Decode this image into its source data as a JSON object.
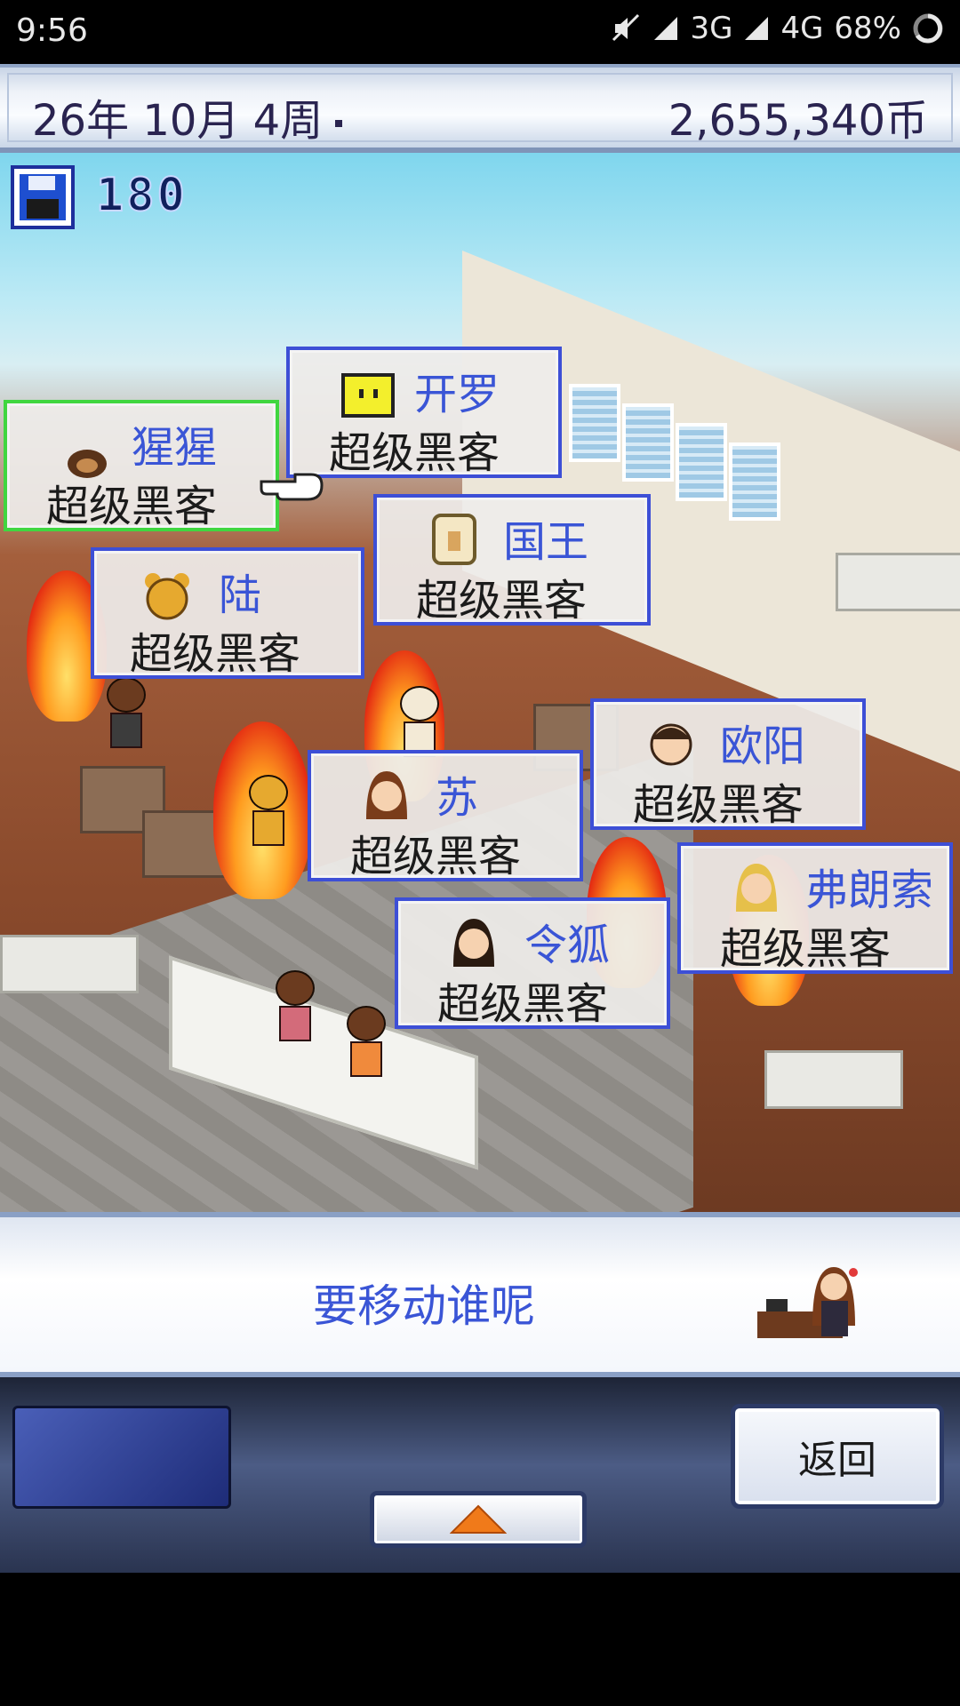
{
  "status_bar": {
    "time": "9:56",
    "network_3g": "3G",
    "network_4g": "4G",
    "battery": "68%"
  },
  "header": {
    "date": "26年 10月 4周",
    "money": "2,655,340币"
  },
  "save_count": "180",
  "employees": [
    {
      "name": "猩猩",
      "role": "超级黑客",
      "avatar": "gorilla-avatar-icon",
      "selected": true
    },
    {
      "name": "开罗",
      "role": "超级黑客",
      "avatar": "kairo-robot-avatar-icon"
    },
    {
      "name": "国王",
      "role": "超级黑客",
      "avatar": "king-avatar-icon"
    },
    {
      "name": "陆",
      "role": "超级黑客",
      "avatar": "bear-avatar-icon"
    },
    {
      "name": "欧阳",
      "role": "超级黑客",
      "avatar": "man-avatar-icon"
    },
    {
      "name": "苏",
      "role": "超级黑客",
      "avatar": "woman-avatar-icon"
    },
    {
      "name": "弗朗索",
      "role": "超级黑客",
      "avatar": "blonde-avatar-icon"
    },
    {
      "name": "令狐",
      "role": "超级黑客",
      "avatar": "woman-dark-hair-avatar-icon"
    }
  ],
  "message": "要移动谁呢",
  "buttons": {
    "back": "返回",
    "up": "▲"
  },
  "colors": {
    "card_border": "#3d4fd6",
    "card_selected_border": "#40d640",
    "name_text": "#3a55d6",
    "fire": "#ff9c1f"
  }
}
